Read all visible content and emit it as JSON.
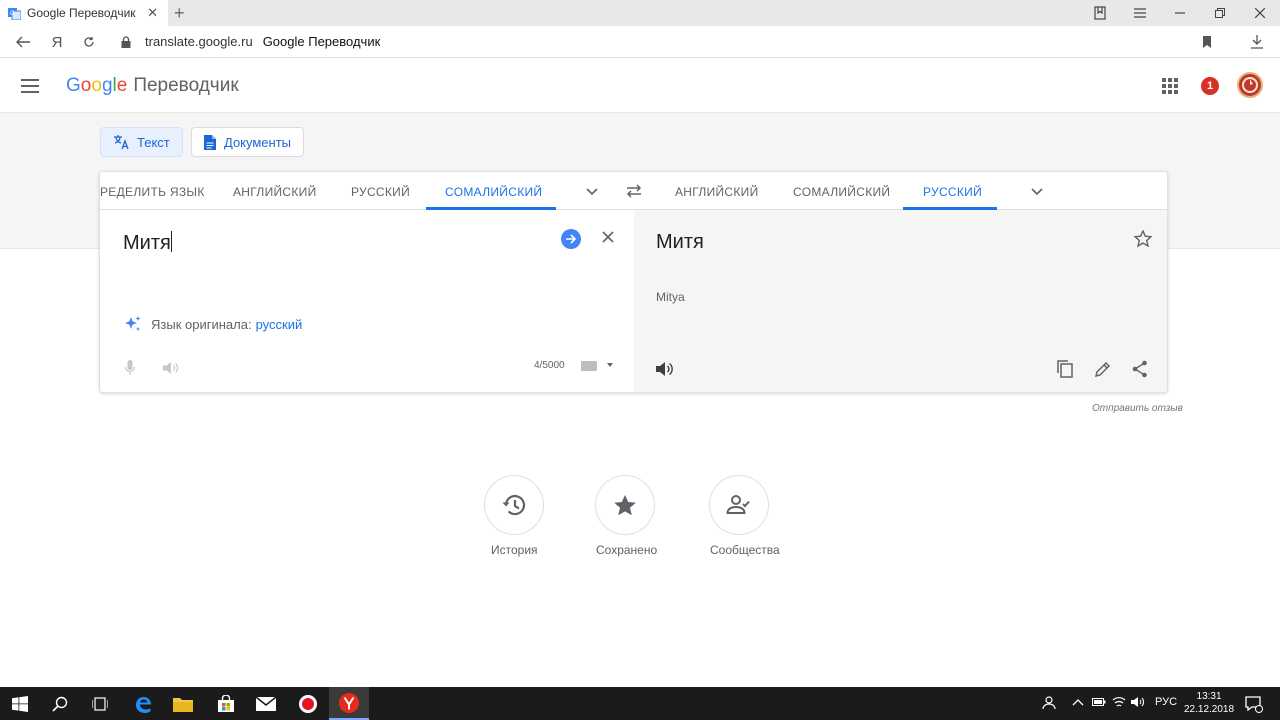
{
  "browser": {
    "tab_title": "Google Переводчик",
    "tab_close": "✕",
    "new_tab": "+",
    "url": "translate.google.ru",
    "page_title": "Google Переводчик",
    "yandex_glyph": "Я"
  },
  "header": {
    "logo_letters": [
      "G",
      "o",
      "o",
      "g",
      "l",
      "e"
    ],
    "product": "Переводчик",
    "notification_count": "1"
  },
  "modes": {
    "text_label": "Текст",
    "docs_label": "Документы",
    "active": "text"
  },
  "source_langs": [
    "РЕДЕЛИТЬ ЯЗЫК",
    "АНГЛИЙСКИЙ",
    "РУССКИЙ",
    "СОМАЛИЙСКИЙ"
  ],
  "source_active_index": 3,
  "target_langs": [
    "АНГЛИЙСКИЙ",
    "СОМАЛИЙСКИЙ",
    "РУССКИЙ"
  ],
  "target_active_index": 2,
  "source": {
    "text": "Митя",
    "detected_prefix": "Язык оригинала:",
    "detected_lang": "русский",
    "counter": "4/5000"
  },
  "target": {
    "text": "Митя",
    "transliteration": "Mitya"
  },
  "feedback": "Отправить отзыв",
  "bottom": {
    "history": "История",
    "saved": "Сохранено",
    "community": "Сообщества"
  },
  "taskbar": {
    "lang": "РУС",
    "time": "13:31",
    "date": "22.12.2018"
  },
  "colors": {
    "accent": "#1a73e8",
    "notification": "#d93025",
    "taskbar": "#1b1b1b"
  }
}
